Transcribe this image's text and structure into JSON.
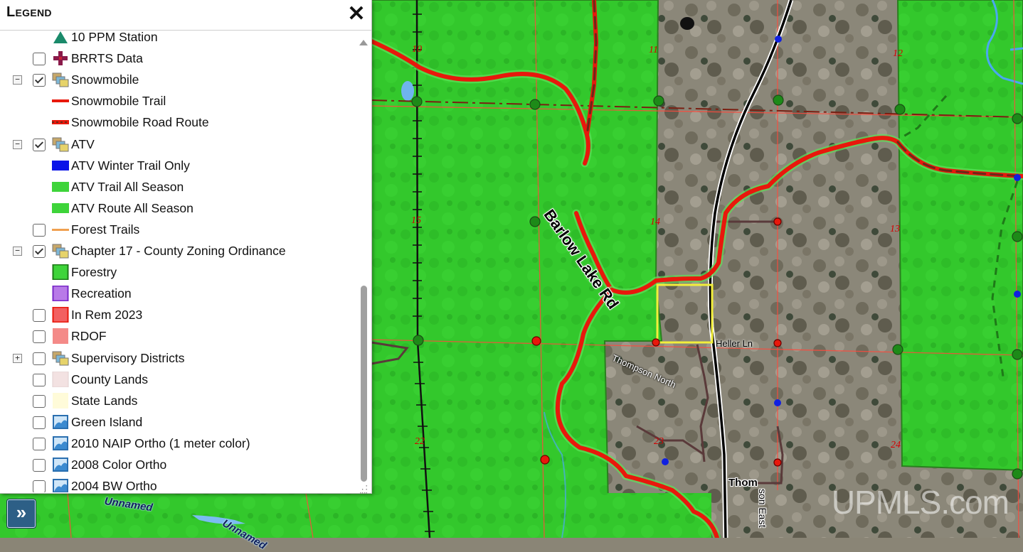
{
  "legend": {
    "title": "Legend",
    "close_glyph": "✕",
    "items": [
      {
        "label": "10 PPM Station",
        "symbol": "green-triangle-icon",
        "expander": "",
        "checkbox": "none"
      },
      {
        "label": "BRRTS Data",
        "symbol": "purple-cross-icon",
        "expander": "",
        "checkbox": "off"
      },
      {
        "label": "Snowmobile",
        "symbol": "layer-group-icon",
        "expander": "−",
        "checkbox": "on"
      },
      {
        "label": "Snowmobile Trail",
        "symbol": "red-line-icon",
        "expander": "",
        "checkbox": "none"
      },
      {
        "label": "Snowmobile Road Route",
        "symbol": "red-dashed-line-icon",
        "expander": "",
        "checkbox": "none"
      },
      {
        "label": "ATV",
        "symbol": "layer-group-icon",
        "expander": "−",
        "checkbox": "on"
      },
      {
        "label": "ATV Winter Trail Only",
        "symbol": "blue-bar-icon",
        "expander": "",
        "checkbox": "none"
      },
      {
        "label": "ATV Trail All Season",
        "symbol": "green-bar-icon",
        "expander": "",
        "checkbox": "none"
      },
      {
        "label": "ATV Route All Season",
        "symbol": "green-bar-icon",
        "expander": "",
        "checkbox": "none"
      },
      {
        "label": "Forest Trails",
        "symbol": "orange-line-icon",
        "expander": "",
        "checkbox": "off"
      },
      {
        "label": "Chapter 17 - County Zoning Ordinance",
        "symbol": "layer-group-icon",
        "expander": "−",
        "checkbox": "on"
      },
      {
        "label": "Forestry",
        "symbol": "green-square-icon",
        "expander": "",
        "checkbox": "none"
      },
      {
        "label": "Recreation",
        "symbol": "purple-square-icon",
        "expander": "",
        "checkbox": "none"
      },
      {
        "label": "In Rem 2023",
        "symbol": "red-square-icon",
        "expander": "",
        "checkbox": "off"
      },
      {
        "label": "RDOF",
        "symbol": "pink-fill-icon",
        "expander": "",
        "checkbox": "off"
      },
      {
        "label": "Supervisory Districts",
        "symbol": "layer-group-icon",
        "expander": "+",
        "checkbox": "off"
      },
      {
        "label": "County Lands",
        "symbol": "light-pink-fill-icon",
        "expander": "",
        "checkbox": "off"
      },
      {
        "label": "State Lands",
        "symbol": "light-yellow-fill-icon",
        "expander": "",
        "checkbox": "off"
      },
      {
        "label": "Green Island",
        "symbol": "image-layer-icon",
        "expander": "",
        "checkbox": "off"
      },
      {
        "label": "2010 NAIP Ortho (1 meter color)",
        "symbol": "image-layer-icon",
        "expander": "",
        "checkbox": "off"
      },
      {
        "label": "2008 Color Ortho",
        "symbol": "image-layer-icon",
        "expander": "",
        "checkbox": "off"
      },
      {
        "label": "2004 BW Ortho",
        "symbol": "image-layer-icon",
        "expander": "",
        "checkbox": "off"
      }
    ]
  },
  "expand_button": {
    "glyph": "»"
  },
  "map": {
    "section_numbers": [
      "10",
      "11",
      "12",
      "15",
      "14",
      "13",
      "22",
      "23",
      "24"
    ],
    "roads": {
      "barlow": "Barlow Lake Rd",
      "heller": "Heller Ln",
      "thompson_north": "Thompson North",
      "thom": "Thom",
      "thompson_east": "son East",
      "unnamed_1": "Unnamed",
      "unnamed_2": "Unnamed"
    },
    "watermark": "UPMLS.com"
  },
  "colors": {
    "forestry_green": "#2fd32a",
    "snowmobile_red": "#e8180c",
    "atv_green": "#4fd64a",
    "parcel_yellow": "#f2ee3c",
    "section_line": "#ff3b30",
    "panel_button": "#2d5f86"
  }
}
